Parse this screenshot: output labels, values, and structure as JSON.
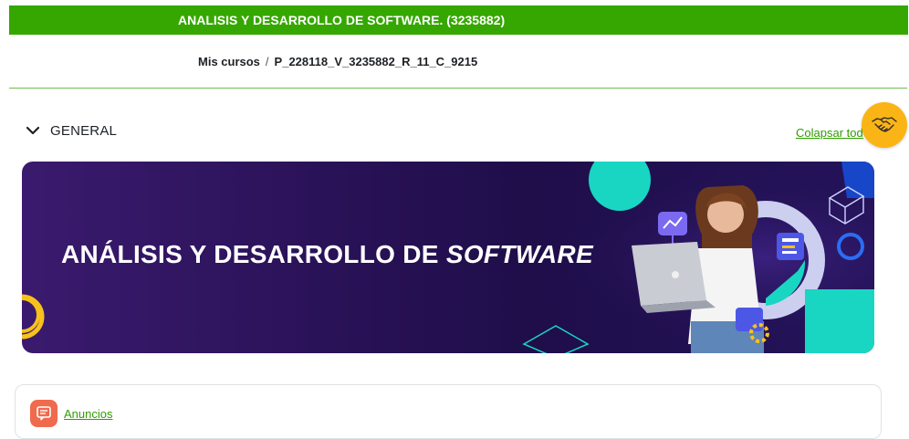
{
  "header": {
    "course_title": "ANALISIS Y DESARROLLO DE SOFTWARE. (3235882)"
  },
  "breadcrumb": {
    "items": [
      "Mis cursos",
      "P_228118_V_3235882_R_11_C_9215"
    ],
    "separator": "/"
  },
  "section": {
    "title": "GENERAL",
    "collapse_label": "Colapsar todo"
  },
  "banner": {
    "title_main": "ANÁLISIS Y DESARROLLO DE ",
    "title_italic": "SOFTWARE"
  },
  "activities": [
    {
      "label": "Anuncios",
      "icon": "forum-icon"
    }
  ],
  "colors": {
    "header_green": "#35a700",
    "link_green": "#2f9e00",
    "float_button": "#fbb415",
    "banner_bg": "#2a1258",
    "forum_icon_bg": "#f06a4d"
  }
}
